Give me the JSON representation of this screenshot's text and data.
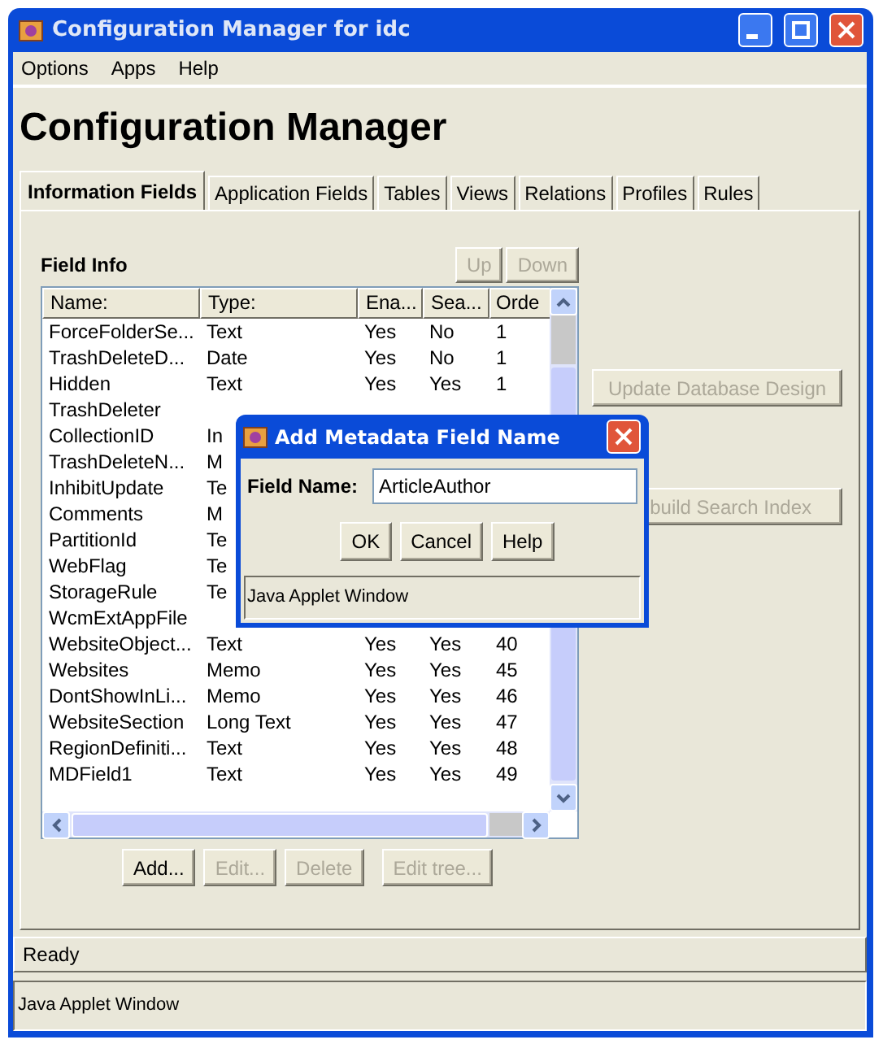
{
  "window": {
    "title": "Configuration Manager for idc"
  },
  "menu": [
    "Options",
    "Apps",
    "Help"
  ],
  "heading": "Configuration Manager",
  "tabs": [
    {
      "label": "Information Fields",
      "selected": true
    },
    {
      "label": "Application Fields",
      "selected": false
    },
    {
      "label": "Tables",
      "selected": false
    },
    {
      "label": "Views",
      "selected": false
    },
    {
      "label": "Relations",
      "selected": false
    },
    {
      "label": "Profiles",
      "selected": false
    },
    {
      "label": "Rules",
      "selected": false
    }
  ],
  "field_info": {
    "label": "Field Info",
    "buttons": [
      {
        "label": "Up",
        "disabled": true
      },
      {
        "label": "Down",
        "disabled": true
      }
    ]
  },
  "table": {
    "columns": [
      "Name:",
      "Type:",
      "Ena...",
      "Sea...",
      "Orde"
    ],
    "rows": [
      [
        "ForceFolderSe...",
        "Text",
        "Yes",
        "No",
        "1"
      ],
      [
        "TrashDeleteD...",
        "Date",
        "Yes",
        "No",
        "1"
      ],
      [
        "Hidden",
        "Text",
        "Yes",
        "Yes",
        "1"
      ],
      [
        "TrashDeleter",
        null,
        null,
        null,
        null
      ],
      [
        "CollectionID",
        "In",
        null,
        null,
        null
      ],
      [
        "TrashDeleteN...",
        "M",
        null,
        null,
        null
      ],
      [
        "InhibitUpdate",
        "Te",
        null,
        null,
        null
      ],
      [
        "Comments",
        "M",
        null,
        null,
        null
      ],
      [
        "PartitionId",
        "Te",
        null,
        null,
        null
      ],
      [
        "WebFlag",
        "Te",
        null,
        null,
        null
      ],
      [
        "StorageRule",
        "Te",
        null,
        null,
        null
      ],
      [
        "WcmExtAppFile",
        null,
        null,
        null,
        null
      ],
      [
        "WebsiteObject...",
        "Text",
        "Yes",
        "Yes",
        "40"
      ],
      [
        "Websites",
        "Memo",
        "Yes",
        "Yes",
        "45"
      ],
      [
        "DontShowInLi...",
        "Memo",
        "Yes",
        "Yes",
        "46"
      ],
      [
        "WebsiteSection",
        "Long Text",
        "Yes",
        "Yes",
        "47"
      ],
      [
        "RegionDefiniti...",
        "Text",
        "Yes",
        "Yes",
        "48"
      ],
      [
        "MDField1",
        "Text",
        "Yes",
        "Yes",
        "49"
      ]
    ]
  },
  "side_buttons": [
    {
      "label": "Update Database Design",
      "disabled": true
    },
    {
      "label": "build Search Index",
      "disabled": true
    }
  ],
  "actions": [
    {
      "label": "Add...",
      "disabled": false
    },
    {
      "label": "Edit...",
      "disabled": true
    },
    {
      "label": "Delete",
      "disabled": true
    },
    {
      "label": "Edit tree...",
      "disabled": true
    }
  ],
  "status_bar": "Ready",
  "applet_notice": "Java Applet Window",
  "dialog": {
    "title": "Add Metadata Field Name",
    "field_label": "Field Name:",
    "value": "ArticleAuthor",
    "buttons": [
      "OK",
      "Cancel",
      "Help"
    ],
    "applet_notice": "Java Applet Window"
  }
}
